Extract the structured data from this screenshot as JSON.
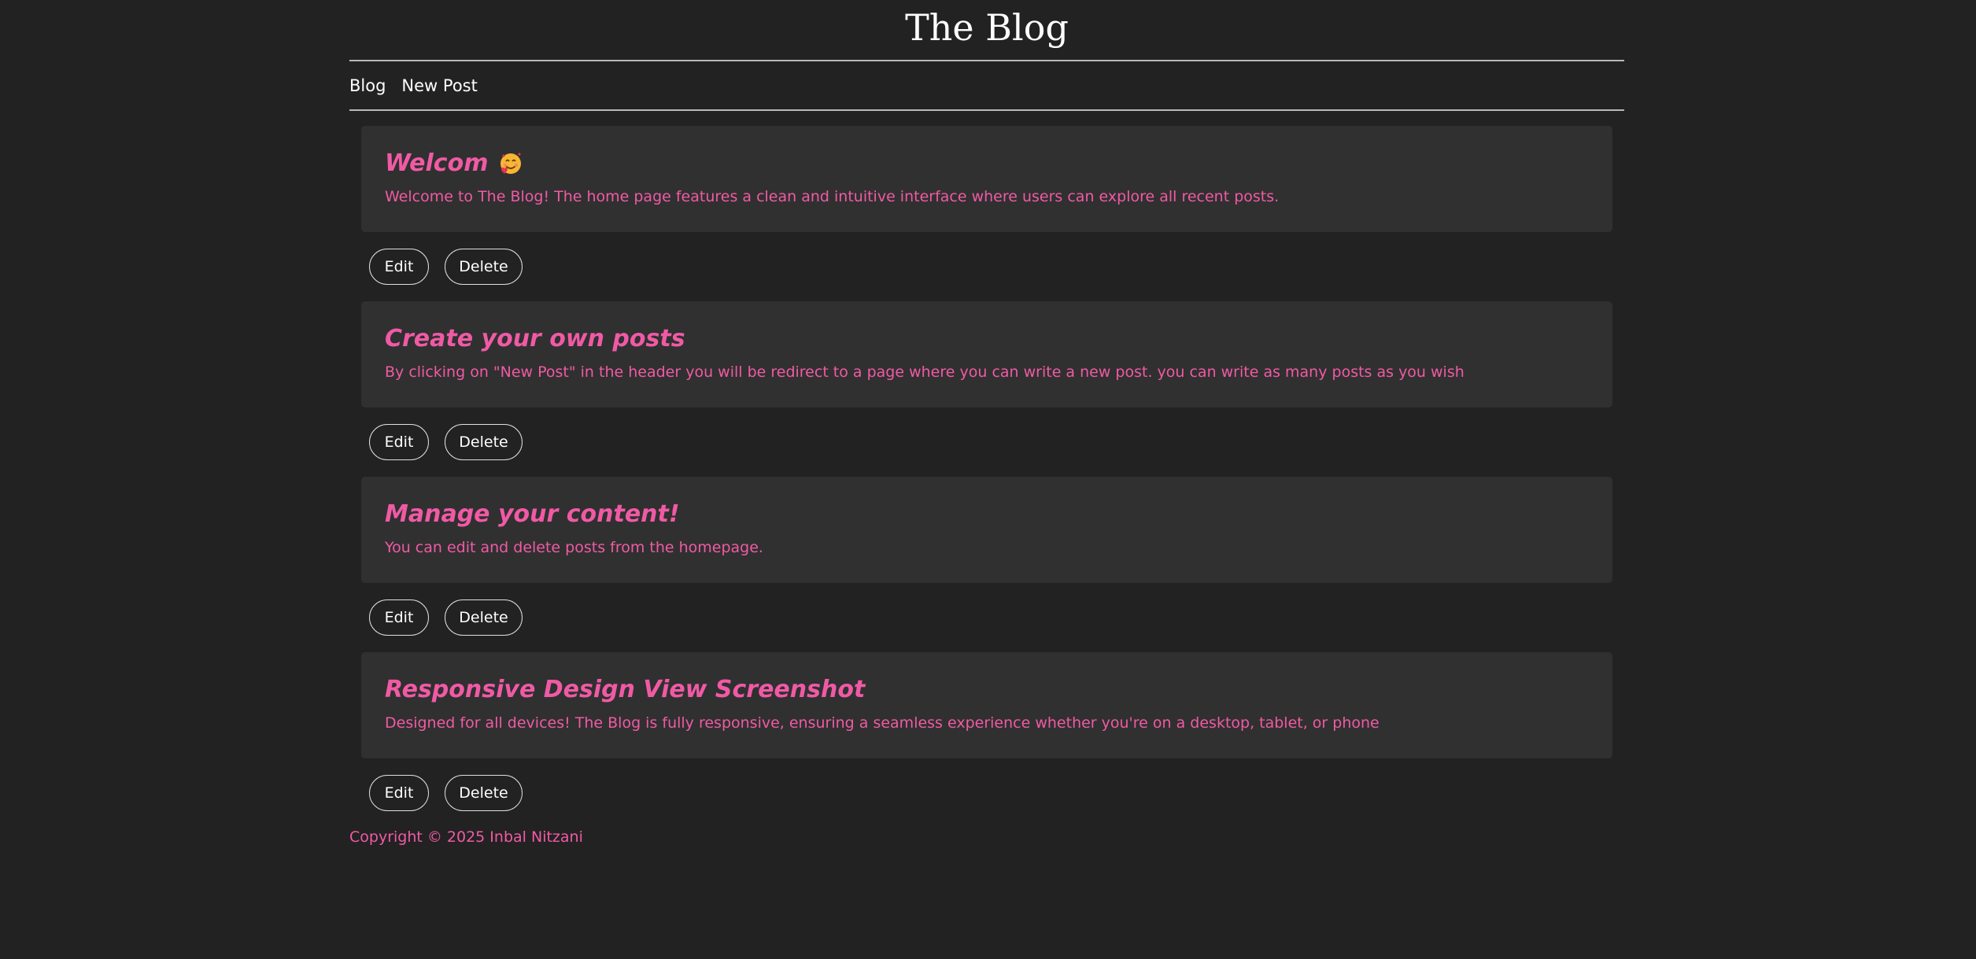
{
  "header": {
    "title": "The Blog"
  },
  "nav": {
    "items": [
      {
        "label": "Blog"
      },
      {
        "label": "New Post"
      }
    ]
  },
  "posts": [
    {
      "title": "Welcom",
      "emoji": "smiling-face-with-hearts-icon",
      "body": "Welcome to The Blog! The home page features a clean and intuitive interface where users can explore all recent posts.",
      "edit_label": "Edit",
      "delete_label": "Delete"
    },
    {
      "title": "Create your own posts",
      "body": "By clicking on \"New Post\" in the header you will be redirect to a page where you can write a new post. you can write as many posts as you wish",
      "edit_label": "Edit",
      "delete_label": "Delete"
    },
    {
      "title": "Manage your content!",
      "body": "You can edit and delete posts from the homepage.",
      "edit_label": "Edit",
      "delete_label": "Delete"
    },
    {
      "title": "Responsive Design View Screenshot",
      "body": "Designed for all devices! The Blog is fully responsive, ensuring a seamless experience whether you're on a desktop, tablet, or phone",
      "edit_label": "Edit",
      "delete_label": "Delete"
    }
  ],
  "footer": {
    "copyright": "Copyright © 2025 Inbal Nitzani"
  },
  "colors": {
    "background": "#222222",
    "card": "#303030",
    "accent": "#f05aa5",
    "text": "#ffffff",
    "rule": "#b8b8b8"
  }
}
